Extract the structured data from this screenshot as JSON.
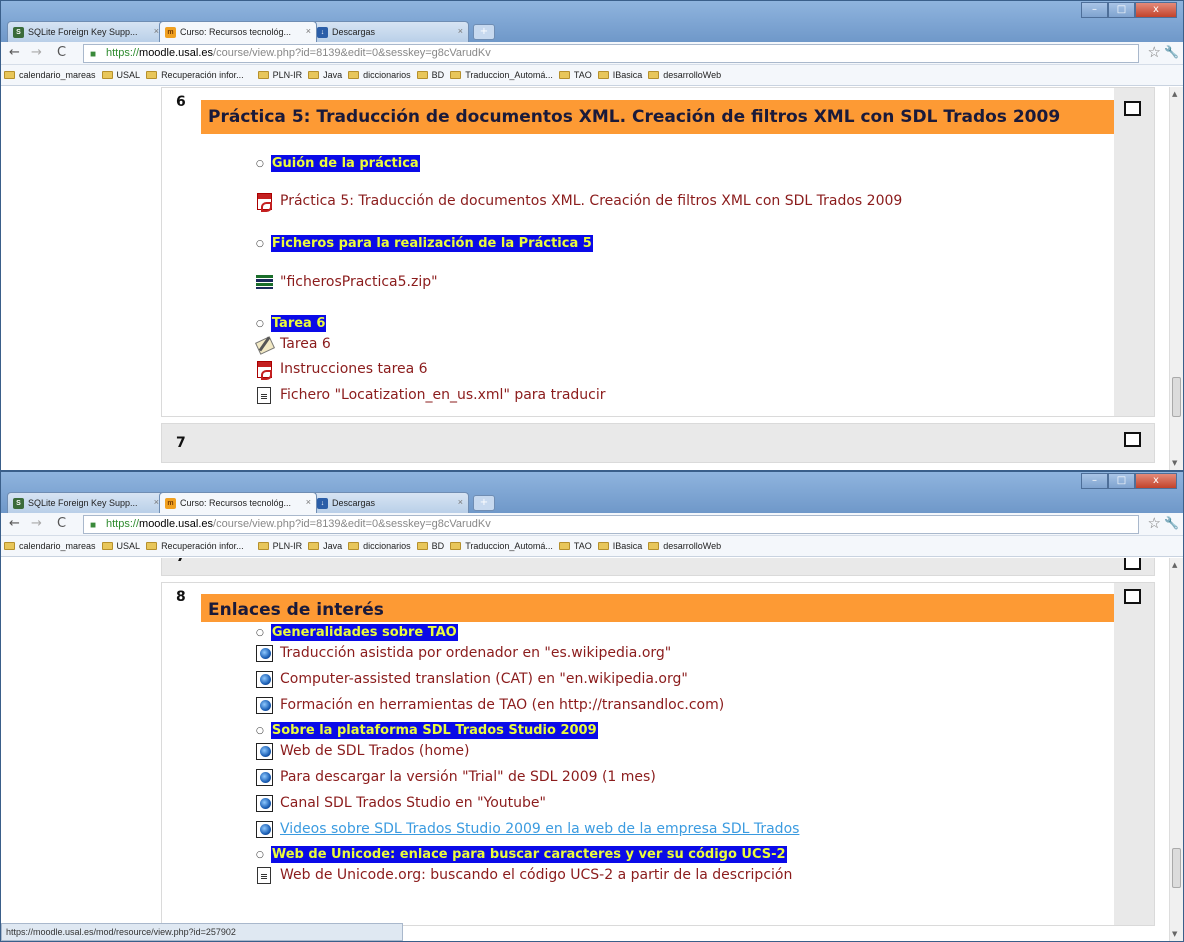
{
  "browser": {
    "tabs": [
      {
        "label": "SQLite Foreign Key Supp...",
        "icon": "sqlite-favicon"
      },
      {
        "label": "Curso: Recursos tecnológ...",
        "icon": "moodle-favicon"
      },
      {
        "label": "Descargas",
        "icon": "downloads-favicon"
      }
    ],
    "url_scheme": "https://",
    "url_host": "moodle.usal.es",
    "url_path": "/course/view.php?id=8139&edit=0&sesskey=g8cVarudKv",
    "bookmarks": [
      "calendario_mareas",
      "USAL",
      "Recuperación infor...",
      "PLN-IR",
      "Java",
      "diccionarios",
      "BD",
      "Traduccion_Automá...",
      "TAO",
      "IBasica",
      "desarrolloWeb"
    ]
  },
  "top": {
    "section6": {
      "number": "6",
      "title": "Práctica 5: Traducción de documentos XML. Creación de filtros XML con SDL Trados 2009",
      "topic1": "Guión de la práctica",
      "res1": "Práctica 5: Traducción de documentos XML. Creación de filtros XML con SDL Trados 2009",
      "topic2": "Ficheros para la realización de la Práctica 5",
      "res2": "\"ficherosPractica5.zip\"",
      "topic3": "Tarea 6",
      "res3": "Tarea 6",
      "res4": "Instrucciones tarea 6",
      "res5": "Fichero \"Locatization_en_us.xml\" para traducir"
    },
    "section7": {
      "number": "7"
    }
  },
  "bottom": {
    "section7_partial": {
      "number": "7"
    },
    "section8": {
      "number": "8",
      "title": "Enlaces de interés",
      "topic1": "Generalidades sobre TAO",
      "links1": [
        "Traducción asistida por ordenador en \"es.wikipedia.org\"",
        "Computer-assisted translation (CAT) en \"en.wikipedia.org\"",
        "Formación en herramientas de TAO (en http://transandloc.com)"
      ],
      "topic2": "Sobre la plataforma SDL Trados Studio 2009",
      "links2": [
        "Web de SDL Trados (home)",
        "Para descargar la versión \"Trial\" de SDL 2009 (1 mes)",
        "Canal SDL Trados Studio en \"Youtube\"",
        "Videos sobre SDL Trados Studio 2009 en la web de la empresa SDL Trados"
      ],
      "topic3": "Web de Unicode: enlace para buscar caracteres y ver su código UCS-2",
      "links3": [
        "Web de Unicode.org: buscando el código UCS-2 a partir de la descripción"
      ]
    },
    "status_url": "https://moodle.usal.es/mod/resource/view.php?id=257902"
  },
  "colors": {
    "section_header": "#fd9a34",
    "topic_bg": "#0a0ae8",
    "topic_text": "#ecfc3c",
    "resource_text": "#8b1c1c",
    "visited_link": "#3b9be0"
  }
}
